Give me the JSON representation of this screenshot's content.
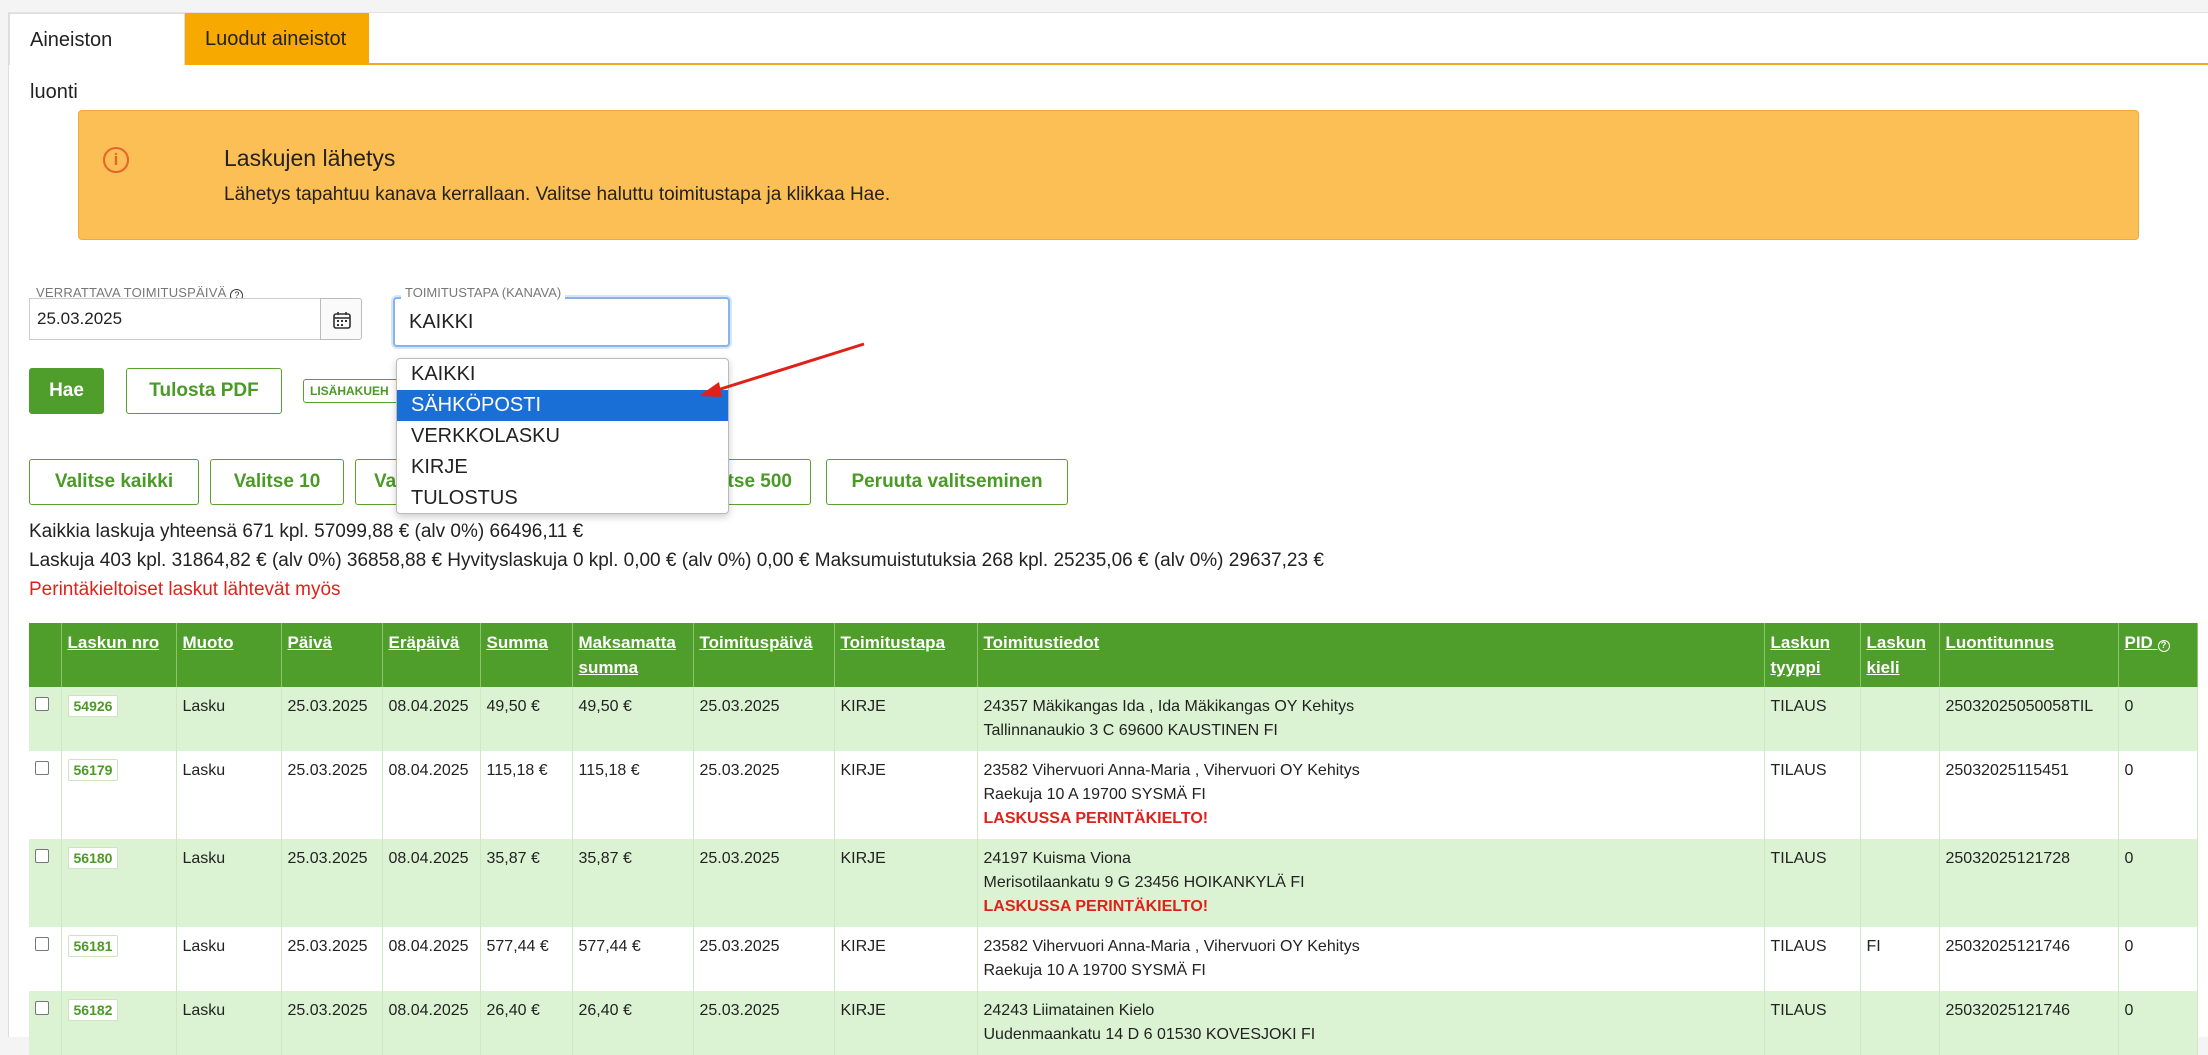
{
  "tabs": [
    "Aineiston luonti",
    "Luodut aineistot"
  ],
  "alert": {
    "icon": "info-icon",
    "title": "Laskujen lähetys",
    "text": "Lähetys tapahtuu kanava kerrallaan. Valitse haluttu toimitustapa ja klikkaa Hae."
  },
  "filters": {
    "date_label": "VERRATTAVA TOIMITUSPÄIVÄ",
    "date_value": "25.03.2025",
    "channel_label": "TOIMITUSTAPA (KANAVA)",
    "channel_value": "KAIKKI",
    "channel_options": [
      "KAIKKI",
      "SÄHKÖPOSTI",
      "VERKKOLASKU",
      "KIRJE",
      "TULOSTUS"
    ],
    "channel_highlighted": "SÄHKÖPOSTI"
  },
  "actions": {
    "search": "Hae",
    "print_pdf": "Tulosta PDF",
    "extra": "LISÄHAKUEH"
  },
  "selection_buttons": [
    "Valitse kaikki",
    "Valitse 10",
    "Va",
    "tse 500",
    "Peruuta valitseminen"
  ],
  "summary": {
    "line1": "Kaikkia laskuja yhteensä 671 kpl. 57099,88 € (alv 0%)  66496,11 €",
    "line2": "Laskuja 403 kpl. 31864,82 € (alv 0%)  36858,88 €   Hyvityslaskuja 0 kpl. 0,00 € (alv 0%)  0,00 €   Maksumuistutuksia 268 kpl. 25235,06 € (alv 0%)  29637,23 €",
    "warning": "Perintäkieltoiset laskut lähtevät myös"
  },
  "table": {
    "headers": [
      "Laskun nro",
      "Muoto",
      "Päivä",
      "Eräpäivä",
      "Summa",
      "Maksamatta summa",
      "Toimituspäivä",
      "Toimitustapa",
      "Toimitustiedot",
      "Laskun tyyppi",
      "Laskun kieli",
      "Luontitunnus",
      "PID"
    ],
    "rows": [
      {
        "nro": "54926",
        "muoto": "Lasku",
        "paiva": "25.03.2025",
        "era": "08.04.2025",
        "summa": "49,50 €",
        "maksamatta": "49,50 €",
        "toimpaiva": "25.03.2025",
        "tapa": "KIRJE",
        "tiedot1": "24357 Mäkikangas Ida , Ida Mäkikangas OY Kehitys",
        "tiedot2": "Tallinnanaukio 3 C 69600 KAUSTINEN FI",
        "varoitus": "",
        "tyyppi": "TILAUS",
        "kieli": "",
        "tunnus": "25032025050058TIL",
        "pid": "0"
      },
      {
        "nro": "56179",
        "muoto": "Lasku",
        "paiva": "25.03.2025",
        "era": "08.04.2025",
        "summa": "115,18 €",
        "maksamatta": "115,18 €",
        "toimpaiva": "25.03.2025",
        "tapa": "KIRJE",
        "tiedot1": "23582 Vihervuori Anna-Maria , Vihervuori OY Kehitys",
        "tiedot2": "Raekuja 10 A 19700 SYSMÄ FI",
        "varoitus": "LASKUSSA PERINTÄKIELTO!",
        "tyyppi": "TILAUS",
        "kieli": "",
        "tunnus": "25032025115451",
        "pid": "0"
      },
      {
        "nro": "56180",
        "muoto": "Lasku",
        "paiva": "25.03.2025",
        "era": "08.04.2025",
        "summa": "35,87 €",
        "maksamatta": "35,87 €",
        "toimpaiva": "25.03.2025",
        "tapa": "KIRJE",
        "tiedot1": "24197 Kuisma Viona",
        "tiedot2": "Merisotilaankatu 9 G 23456 HOIKANKYLÄ FI",
        "varoitus": "LASKUSSA PERINTÄKIELTO!",
        "tyyppi": "TILAUS",
        "kieli": "",
        "tunnus": "25032025121728",
        "pid": "0"
      },
      {
        "nro": "56181",
        "muoto": "Lasku",
        "paiva": "25.03.2025",
        "era": "08.04.2025",
        "summa": "577,44 €",
        "maksamatta": "577,44 €",
        "toimpaiva": "25.03.2025",
        "tapa": "KIRJE",
        "tiedot1": "23582 Vihervuori Anna-Maria , Vihervuori OY Kehitys",
        "tiedot2": "Raekuja 10 A 19700 SYSMÄ FI",
        "varoitus": "",
        "tyyppi": "TILAUS",
        "kieli": "FI",
        "tunnus": "25032025121746",
        "pid": "0"
      },
      {
        "nro": "56182",
        "muoto": "Lasku",
        "paiva": "25.03.2025",
        "era": "08.04.2025",
        "summa": "26,40 €",
        "maksamatta": "26,40 €",
        "toimpaiva": "25.03.2025",
        "tapa": "KIRJE",
        "tiedot1": "24243 Liimatainen Kielo",
        "tiedot2": "Uudenmaankatu 14 D 6 01530 KOVESJOKI FI",
        "varoitus": "",
        "tyyppi": "TILAUS",
        "kieli": "",
        "tunnus": "25032025121746",
        "pid": "0"
      }
    ]
  },
  "colors": {
    "accent_green": "#4f9d2a",
    "tab_orange": "#f7a900",
    "alert_bg": "#fcbf55",
    "row_green": "#dcf3d3",
    "warning_red": "#e0211a",
    "dropdown_highlight": "#1a6fd6"
  }
}
